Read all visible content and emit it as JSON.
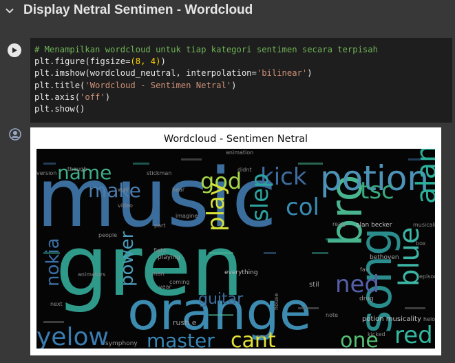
{
  "section": {
    "title": "Display Netral Sentimen - Wordcloud",
    "icon": "chevron-down-icon"
  },
  "cell": {
    "run_icon": "play-icon",
    "output_icon": "user-avatar-icon",
    "code": {
      "comment": "# Menampilkan wordcloud untuk tiap kategori sentimen secara terpisah",
      "line2_prefix": "plt.figure(figsize=",
      "line2_args": "(8, 4)",
      "line2_suffix": ")",
      "line3_prefix": "plt.imshow(wordcloud_neutral, interpolation=",
      "line3_str": "'bilinear'",
      "line3_suffix": ")",
      "line4_prefix": "plt.title(",
      "line4_str": "'Wordcloud - Sentimen Netral'",
      "line4_suffix": ")",
      "line5_prefix": "plt.axis(",
      "line5_str": "'off'",
      "line5_suffix": ")",
      "line6": "plt.show()"
    }
  },
  "figure": {
    "title": "Wordcloud - Sentimen Netral",
    "background": "#050505",
    "words": [
      {
        "text": "music",
        "color": "#3b6e9c"
      },
      {
        "text": "gren",
        "color": "#2f9a8a"
      },
      {
        "text": "orange",
        "color": "#3d8bb0"
      },
      {
        "text": "song",
        "color": "#2a8c8c"
      },
      {
        "text": "bro",
        "color": "#48b58f"
      },
      {
        "text": "potion",
        "color": "#4d93b8"
      },
      {
        "text": "kick",
        "color": "#3e6ca0"
      },
      {
        "text": "god",
        "color": "#a8d74a"
      },
      {
        "text": "name",
        "color": "#3fae8a"
      },
      {
        "text": "make",
        "color": "#4b7cae"
      },
      {
        "text": "play",
        "color": "#d7e33a"
      },
      {
        "text": "slep",
        "color": "#2ba5a0"
      },
      {
        "text": "col",
        "color": "#3a8bb3"
      },
      {
        "text": "tsc",
        "color": "#3ba87e"
      },
      {
        "text": "alan",
        "color": "#2bb09a"
      },
      {
        "text": "blue",
        "color": "#3db5a5"
      },
      {
        "text": "ned",
        "color": "#5560a8"
      },
      {
        "text": "red",
        "color": "#34b89f"
      },
      {
        "text": "one",
        "color": "#55c173"
      },
      {
        "text": "cant",
        "color": "#e4e236"
      },
      {
        "text": "master",
        "color": "#3886b5"
      },
      {
        "text": "yelow",
        "color": "#3a7bb0"
      },
      {
        "text": "nokia",
        "color": "#3b6fa6"
      },
      {
        "text": "power",
        "color": "#4c9cb9"
      },
      {
        "text": "potion musicality",
        "color": "#c6c6c6"
      },
      {
        "text": "alan becker",
        "color": "#bcbcbc"
      },
      {
        "text": "bethoven",
        "color": "#a9a9a9"
      },
      {
        "text": "everything",
        "color": "#b8b8b8"
      },
      {
        "text": "playing",
        "color": "#9a9a9a"
      },
      {
        "text": "guitar",
        "color": "#3d6c9a"
      },
      {
        "text": "rush e",
        "color": "#a0a0a0"
      },
      {
        "text": "drug",
        "color": "#9c9c9c"
      },
      {
        "text": "stil",
        "color": "#a4a4a4"
      },
      {
        "text": "animation",
        "color": "#8e8e8e"
      },
      {
        "text": "symphony",
        "color": "#9a9a9a"
      },
      {
        "text": "imagine",
        "color": "#8f8f8f"
      },
      {
        "text": "fight",
        "color": "#8c8c8c"
      },
      {
        "text": "helo",
        "color": "#8c8c8c"
      },
      {
        "text": "fav",
        "color": "#8c8c8c"
      },
      {
        "text": "part",
        "color": "#8c8c8c"
      },
      {
        "text": "man",
        "color": "#8c8c8c"
      },
      {
        "text": "video",
        "color": "#8c8c8c"
      },
      {
        "text": "way",
        "color": "#8c8c8c"
      },
      {
        "text": "people",
        "color": "#8c8c8c"
      },
      {
        "text": "coming",
        "color": "#8c8c8c"
      },
      {
        "text": "hear",
        "color": "#8c8c8c"
      },
      {
        "text": "realy",
        "color": "#8c8c8c"
      },
      {
        "text": "stickman",
        "color": "#8c8c8c"
      },
      {
        "text": "though",
        "color": "#8c8c8c"
      },
      {
        "text": "version",
        "color": "#8c8c8c"
      },
      {
        "text": "musicality",
        "color": "#8c8c8c"
      },
      {
        "text": "box",
        "color": "#8c8c8c"
      },
      {
        "text": "episode",
        "color": "#8c8c8c"
      },
      {
        "text": "kicked",
        "color": "#8c8c8c"
      },
      {
        "text": "next",
        "color": "#8c8c8c"
      },
      {
        "text": "year",
        "color": "#8c8c8c"
      },
      {
        "text": "note",
        "color": "#8c8c8c"
      },
      {
        "text": "didnt",
        "color": "#8c8c8c"
      },
      {
        "text": "house",
        "color": "#8c8c8c"
      },
      {
        "text": "animators",
        "color": "#8c8c8c"
      }
    ]
  }
}
